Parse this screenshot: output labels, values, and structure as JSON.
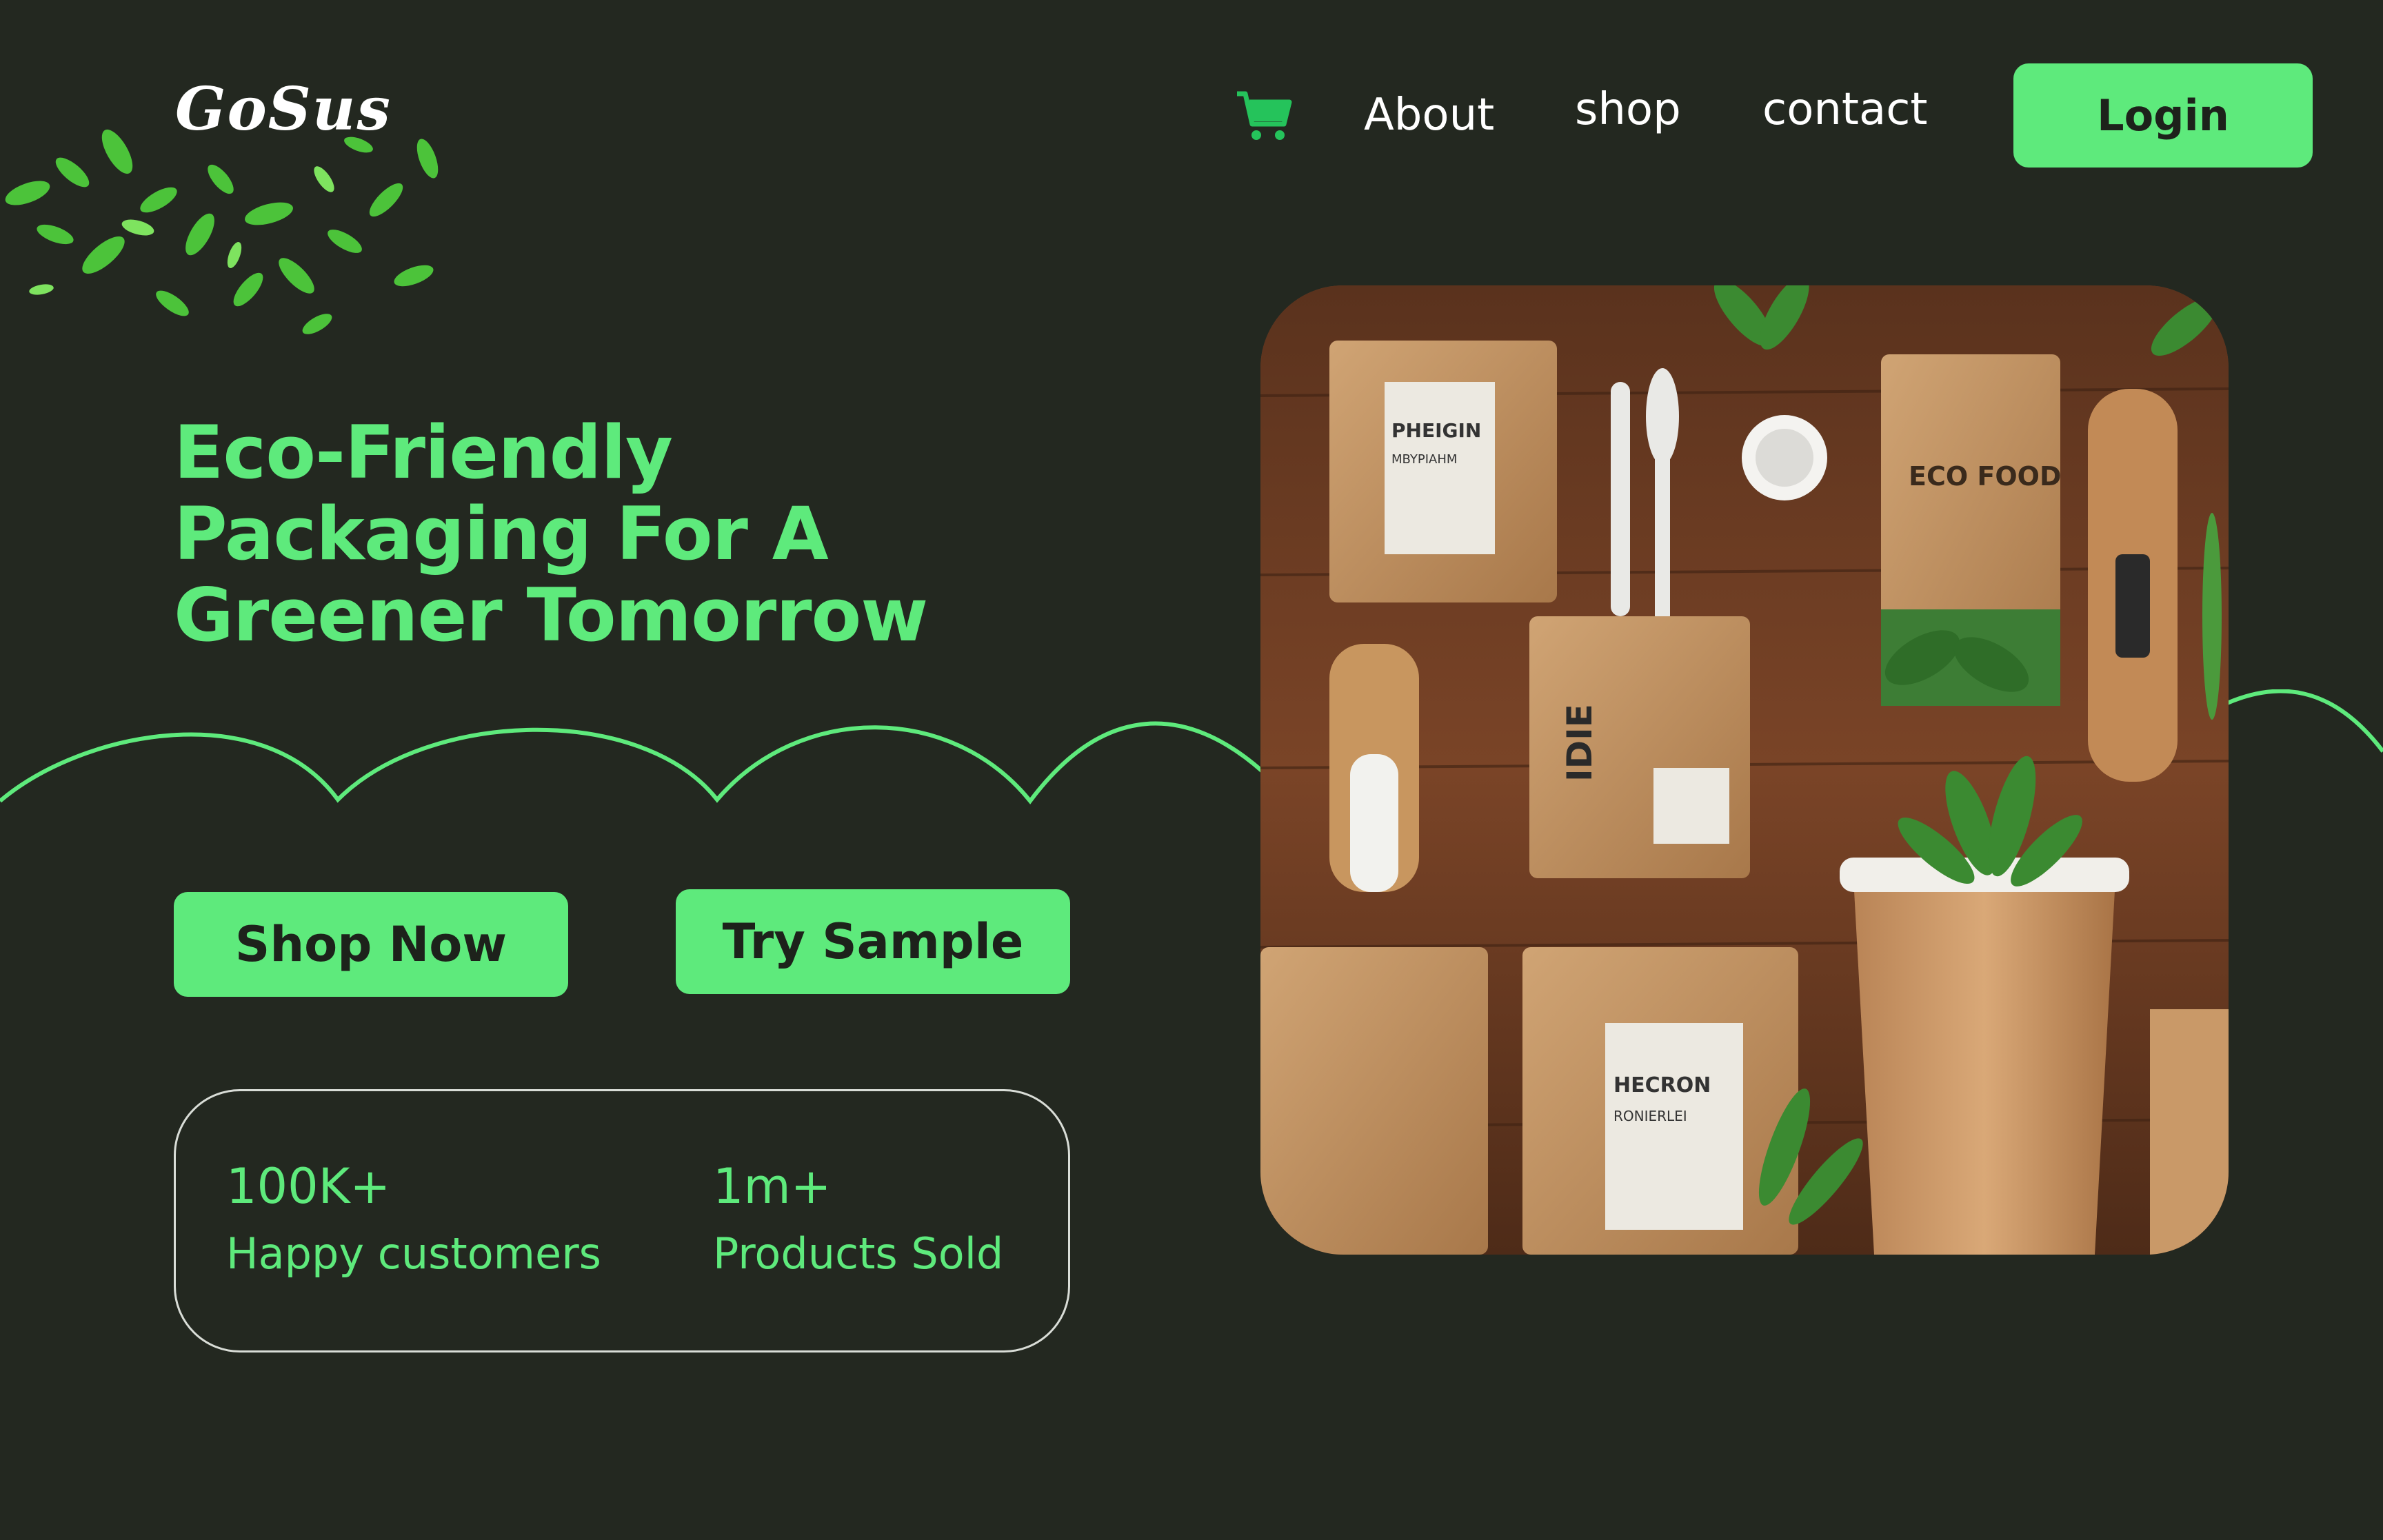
{
  "brand": {
    "logo_text": "GoSus"
  },
  "nav": {
    "about": "About",
    "shop": "shop",
    "contact": "contact",
    "login": "Login",
    "cart_icon": "shopping-cart-icon"
  },
  "hero": {
    "headline_line1": "Eco-Friendly",
    "headline_line2": "Packaging For A",
    "headline_line3": "Greener Tomorrow",
    "shop_now": "Shop Now",
    "try_sample": "Try Sample"
  },
  "stats": [
    {
      "value": "100K+",
      "label": "Happy customers"
    },
    {
      "value": "1m+",
      "label": "Products Sold"
    }
  ],
  "product_image": {
    "label_1": "PHEIGIN",
    "label_1_sub": "MBYPIAHM",
    "label_2": "ECO FOOD",
    "label_3": "IDIE",
    "label_4": "HECRON",
    "label_4_sub": "RONIERLEI"
  },
  "colors": {
    "background": "#232820",
    "accent": "#5EEA7C",
    "text_dark": "#1d221b",
    "white": "#ffffff"
  }
}
